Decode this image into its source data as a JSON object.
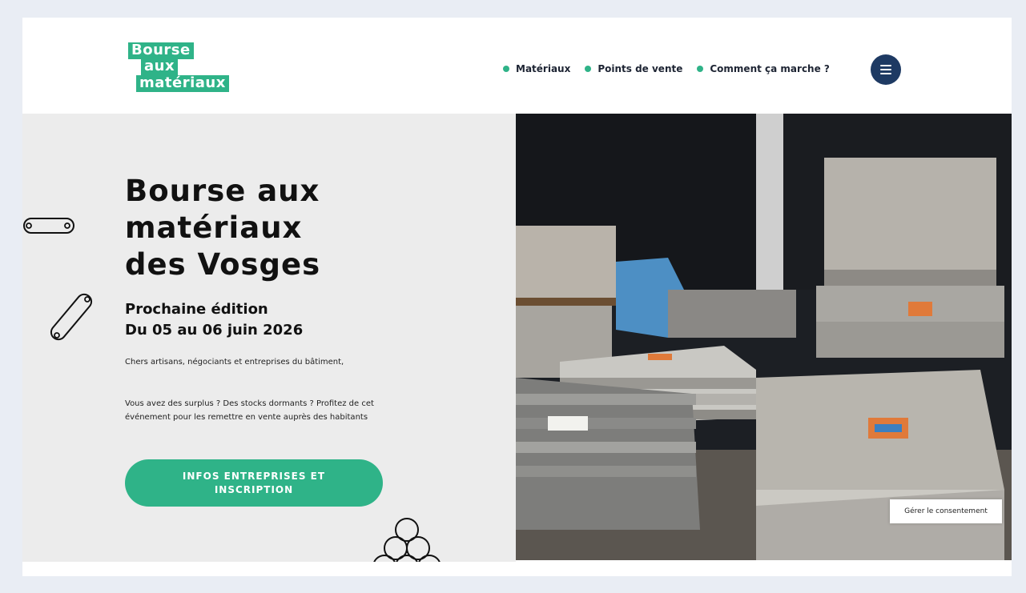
{
  "header": {
    "logo": {
      "line1": "Bourse",
      "line2": "aux",
      "line3": "matériaux"
    },
    "nav": [
      {
        "label": "Matériaux"
      },
      {
        "label": "Points de vente"
      },
      {
        "label": "Comment ça marche ?"
      }
    ],
    "menu_icon": "hamburger-menu-icon"
  },
  "hero": {
    "title_line1": "Bourse aux",
    "title_line2": "matériaux",
    "title_line3": "des Vosges",
    "subtitle_line1": "Prochaine édition",
    "subtitle_line2": "Du 05 au 06 juin 2026",
    "paragraph1": "Chers artisans, négociants et entreprises du bâtiment,",
    "paragraph2": "Vous avez des surplus ? Des stocks dormants ? Profitez de cet événement pour les remettre en vente auprès des habitants",
    "cta_label": "INFOS ENTREPRISES ET INSCRIPTION"
  },
  "consent": {
    "label": "Gérer le consentement"
  },
  "colors": {
    "accent": "#2fb388",
    "navy": "#1e3a63",
    "hero_bg": "#ececec",
    "page_bg": "#e9edf4"
  }
}
